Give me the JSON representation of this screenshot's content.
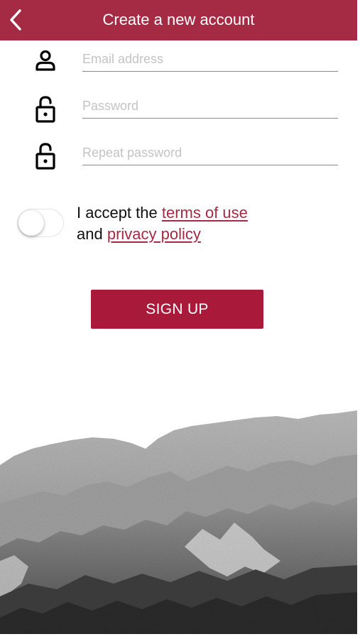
{
  "header": {
    "title": "Create a new account",
    "background_color": "#a52a44"
  },
  "back_icon": "chevron-left-icon",
  "fields": [
    {
      "icon": "user-icon",
      "placeholder": "Email address",
      "value": "",
      "type": "email"
    },
    {
      "icon": "lock-icon",
      "placeholder": "Password",
      "value": "",
      "type": "password"
    },
    {
      "icon": "lock-icon",
      "placeholder": "Repeat password",
      "value": "",
      "type": "password"
    }
  ],
  "terms": {
    "toggle_state": "off",
    "prefix": "I accept the ",
    "terms_link": "terms of use",
    "middle": "and ",
    "privacy_link": "privacy policy",
    "link_color": "#a52a44"
  },
  "signup_button": {
    "label": "SIGN UP",
    "color": "#a8193a"
  },
  "background_image": "mountain-landscape-grayscale"
}
